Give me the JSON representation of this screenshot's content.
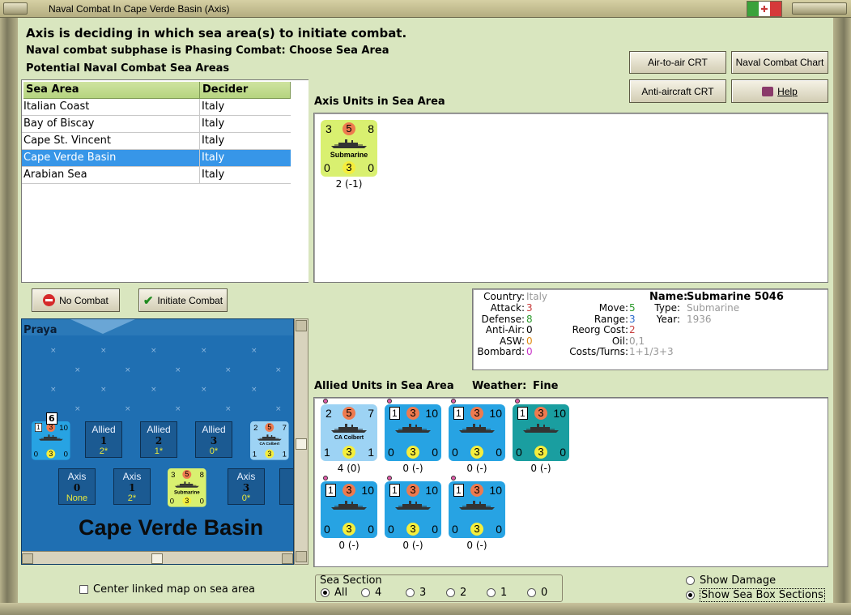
{
  "window": {
    "title": "Naval Combat In Cape Verde Basin (Axis)"
  },
  "headings": {
    "main": "Axis is deciding in which sea area(s) to initiate combat.",
    "subphase": "Naval combat subphase is Phasing Combat: Choose Sea Area",
    "potential": "Potential Naval Combat Sea Areas",
    "axis_units": "Axis Units in Sea Area",
    "allied_units": "Allied Units in Sea Area",
    "weather_label": "Weather:",
    "weather_value": "Fine"
  },
  "buttons": {
    "air_to_air": "Air-to-air CRT",
    "naval_chart": "Naval Combat Chart",
    "anti_aircraft": "Anti-aircraft CRT",
    "help": "Help",
    "no_combat": "No Combat",
    "initiate": "Initiate Combat"
  },
  "table": {
    "headers": [
      "Sea Area",
      "Decider"
    ],
    "rows": [
      {
        "area": "Italian Coast",
        "decider": "Italy",
        "selected": false
      },
      {
        "area": "Bay of Biscay",
        "decider": "Italy",
        "selected": false
      },
      {
        "area": "Cape St. Vincent",
        "decider": "Italy",
        "selected": false
      },
      {
        "area": "Cape Verde Basin",
        "decider": "Italy",
        "selected": true
      },
      {
        "area": "Arabian Sea",
        "decider": "Italy",
        "selected": false
      }
    ]
  },
  "axis_units": [
    {
      "tl": "3",
      "tc": "5",
      "tr": "8",
      "name": "Submarine",
      "bl": "0",
      "bc": "3",
      "br": "0",
      "caption": "2 (-1)"
    }
  ],
  "details": {
    "country_label": "Country:",
    "country": "Italy",
    "attack_label": "Attack:",
    "attack": "3",
    "defense_label": "Defense:",
    "defense": "8",
    "antiair_label": "Anti-Air:",
    "antiair": "0",
    "asw_label": "ASW:",
    "asw": "0",
    "bombard_label": "Bombard:",
    "bombard": "0",
    "move_label": "Move:",
    "move": "5",
    "range_label": "Range:",
    "range": "3",
    "reorg_label": "Reorg Cost:",
    "reorg": "2",
    "oil_label": "Oil:",
    "oil": "0,1",
    "costs_label": "Costs/Turns:",
    "costs": "1+1/3+3",
    "name_label": "Name:",
    "name": "Submarine 5046",
    "type_label": "Type:",
    "type": "Submarine",
    "year_label": "Year:",
    "year": "1936"
  },
  "allied_units": [
    {
      "tl": "2",
      "tc": "5",
      "tr": "7",
      "name": "CA Colbert",
      "bl": "1",
      "bc": "3",
      "br": "1",
      "caption": "4 (0)",
      "style": "ltblue"
    },
    {
      "tl": "1",
      "tc": "3",
      "tr": "10",
      "name": "",
      "bl": "0",
      "bc": "3",
      "br": "0",
      "caption": "0 (-)",
      "style": "blue"
    },
    {
      "tl": "1",
      "tc": "3",
      "tr": "10",
      "name": "",
      "bl": "0",
      "bc": "3",
      "br": "0",
      "caption": "0 (-)",
      "style": "blue"
    },
    {
      "tl": "1",
      "tc": "3",
      "tr": "10",
      "name": "",
      "bl": "0",
      "bc": "3",
      "br": "0",
      "caption": "0 (-)",
      "style": "teal"
    },
    {
      "tl": "1",
      "tc": "3",
      "tr": "10",
      "name": "",
      "bl": "0",
      "bc": "3",
      "br": "0",
      "caption": "0 (-)",
      "style": "blue"
    },
    {
      "tl": "1",
      "tc": "3",
      "tr": "10",
      "name": "",
      "bl": "0",
      "bc": "3",
      "br": "0",
      "caption": "0 (-)",
      "style": "blue"
    },
    {
      "tl": "1",
      "tc": "3",
      "tr": "10",
      "name": "",
      "bl": "0",
      "bc": "3",
      "br": "0",
      "caption": "0 (-)",
      "style": "blue"
    }
  ],
  "map": {
    "port": "Praya",
    "sea_name": "Cape Verde Basin",
    "stack_count": "6",
    "allied_boxes": [
      {
        "label": "Allied",
        "num": "1",
        "sub": "2*"
      },
      {
        "label": "Allied",
        "num": "2",
        "sub": "1*"
      },
      {
        "label": "Allied",
        "num": "3",
        "sub": "0*"
      }
    ],
    "axis_boxes": [
      {
        "label": "Axis",
        "num": "0",
        "sub": "None"
      },
      {
        "label": "Axis",
        "num": "1",
        "sub": "2*"
      },
      {
        "label": "Axis",
        "num": "3",
        "sub": "0*"
      },
      {
        "label": "A"
      }
    ],
    "map_counter_stack": {
      "tl": "1",
      "tc": "3",
      "tr": "10",
      "bl": "0",
      "bc": "3",
      "br": "0"
    },
    "map_colbert": {
      "tl": "2",
      "tc": "5",
      "tr": "7",
      "name": "CA Colbert",
      "bl": "1",
      "bc": "3",
      "br": "1"
    },
    "map_sub": {
      "tl": "3",
      "tc": "5",
      "tr": "8",
      "name": "Submarine",
      "bl": "0",
      "bc": "3",
      "br": "0"
    }
  },
  "options": {
    "center_map": "Center linked map on sea area",
    "show_damage": "Show Damage",
    "show_sea_box": "Show Sea Box Sections"
  },
  "sea_section": {
    "label": "Sea Section",
    "options": [
      "All",
      "4",
      "3",
      "2",
      "1",
      "0"
    ],
    "selected": "All"
  },
  "colors": {
    "selection": "#3796e8",
    "attack": "#c83a3a",
    "defense": "#2a9a2a",
    "move": "#2a9a2a",
    "range": "#2a6acb",
    "reorg": "#c84040",
    "bombard": "#c832c8",
    "asw": "#e08a10"
  }
}
